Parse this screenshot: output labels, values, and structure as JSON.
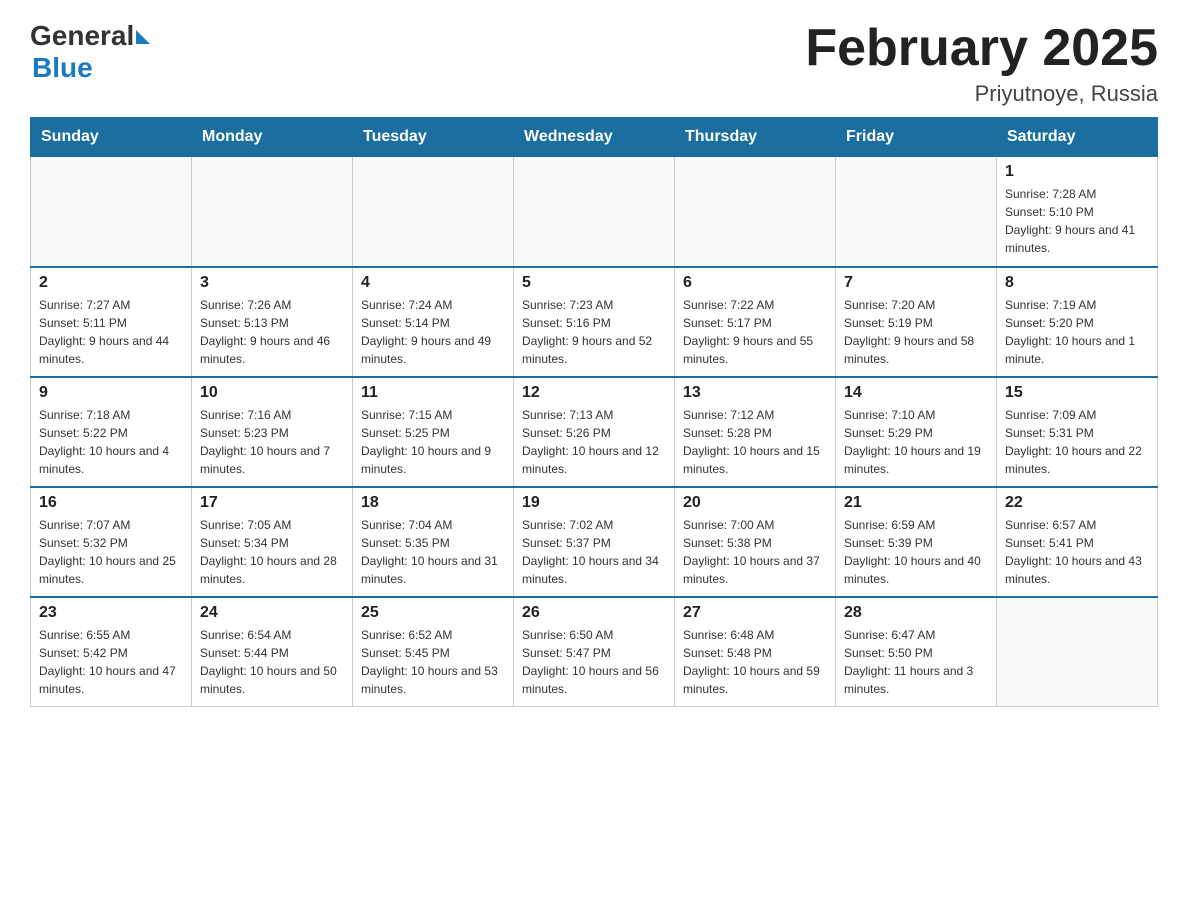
{
  "header": {
    "logo_general": "General",
    "logo_blue": "Blue",
    "month_title": "February 2025",
    "location": "Priyutnoye, Russia"
  },
  "days_of_week": [
    "Sunday",
    "Monday",
    "Tuesday",
    "Wednesday",
    "Thursday",
    "Friday",
    "Saturday"
  ],
  "weeks": [
    {
      "days": [
        {
          "number": "",
          "info": ""
        },
        {
          "number": "",
          "info": ""
        },
        {
          "number": "",
          "info": ""
        },
        {
          "number": "",
          "info": ""
        },
        {
          "number": "",
          "info": ""
        },
        {
          "number": "",
          "info": ""
        },
        {
          "number": "1",
          "info": "Sunrise: 7:28 AM\nSunset: 5:10 PM\nDaylight: 9 hours and 41 minutes."
        }
      ]
    },
    {
      "days": [
        {
          "number": "2",
          "info": "Sunrise: 7:27 AM\nSunset: 5:11 PM\nDaylight: 9 hours and 44 minutes."
        },
        {
          "number": "3",
          "info": "Sunrise: 7:26 AM\nSunset: 5:13 PM\nDaylight: 9 hours and 46 minutes."
        },
        {
          "number": "4",
          "info": "Sunrise: 7:24 AM\nSunset: 5:14 PM\nDaylight: 9 hours and 49 minutes."
        },
        {
          "number": "5",
          "info": "Sunrise: 7:23 AM\nSunset: 5:16 PM\nDaylight: 9 hours and 52 minutes."
        },
        {
          "number": "6",
          "info": "Sunrise: 7:22 AM\nSunset: 5:17 PM\nDaylight: 9 hours and 55 minutes."
        },
        {
          "number": "7",
          "info": "Sunrise: 7:20 AM\nSunset: 5:19 PM\nDaylight: 9 hours and 58 minutes."
        },
        {
          "number": "8",
          "info": "Sunrise: 7:19 AM\nSunset: 5:20 PM\nDaylight: 10 hours and 1 minute."
        }
      ]
    },
    {
      "days": [
        {
          "number": "9",
          "info": "Sunrise: 7:18 AM\nSunset: 5:22 PM\nDaylight: 10 hours and 4 minutes."
        },
        {
          "number": "10",
          "info": "Sunrise: 7:16 AM\nSunset: 5:23 PM\nDaylight: 10 hours and 7 minutes."
        },
        {
          "number": "11",
          "info": "Sunrise: 7:15 AM\nSunset: 5:25 PM\nDaylight: 10 hours and 9 minutes."
        },
        {
          "number": "12",
          "info": "Sunrise: 7:13 AM\nSunset: 5:26 PM\nDaylight: 10 hours and 12 minutes."
        },
        {
          "number": "13",
          "info": "Sunrise: 7:12 AM\nSunset: 5:28 PM\nDaylight: 10 hours and 15 minutes."
        },
        {
          "number": "14",
          "info": "Sunrise: 7:10 AM\nSunset: 5:29 PM\nDaylight: 10 hours and 19 minutes."
        },
        {
          "number": "15",
          "info": "Sunrise: 7:09 AM\nSunset: 5:31 PM\nDaylight: 10 hours and 22 minutes."
        }
      ]
    },
    {
      "days": [
        {
          "number": "16",
          "info": "Sunrise: 7:07 AM\nSunset: 5:32 PM\nDaylight: 10 hours and 25 minutes."
        },
        {
          "number": "17",
          "info": "Sunrise: 7:05 AM\nSunset: 5:34 PM\nDaylight: 10 hours and 28 minutes."
        },
        {
          "number": "18",
          "info": "Sunrise: 7:04 AM\nSunset: 5:35 PM\nDaylight: 10 hours and 31 minutes."
        },
        {
          "number": "19",
          "info": "Sunrise: 7:02 AM\nSunset: 5:37 PM\nDaylight: 10 hours and 34 minutes."
        },
        {
          "number": "20",
          "info": "Sunrise: 7:00 AM\nSunset: 5:38 PM\nDaylight: 10 hours and 37 minutes."
        },
        {
          "number": "21",
          "info": "Sunrise: 6:59 AM\nSunset: 5:39 PM\nDaylight: 10 hours and 40 minutes."
        },
        {
          "number": "22",
          "info": "Sunrise: 6:57 AM\nSunset: 5:41 PM\nDaylight: 10 hours and 43 minutes."
        }
      ]
    },
    {
      "days": [
        {
          "number": "23",
          "info": "Sunrise: 6:55 AM\nSunset: 5:42 PM\nDaylight: 10 hours and 47 minutes."
        },
        {
          "number": "24",
          "info": "Sunrise: 6:54 AM\nSunset: 5:44 PM\nDaylight: 10 hours and 50 minutes."
        },
        {
          "number": "25",
          "info": "Sunrise: 6:52 AM\nSunset: 5:45 PM\nDaylight: 10 hours and 53 minutes."
        },
        {
          "number": "26",
          "info": "Sunrise: 6:50 AM\nSunset: 5:47 PM\nDaylight: 10 hours and 56 minutes."
        },
        {
          "number": "27",
          "info": "Sunrise: 6:48 AM\nSunset: 5:48 PM\nDaylight: 10 hours and 59 minutes."
        },
        {
          "number": "28",
          "info": "Sunrise: 6:47 AM\nSunset: 5:50 PM\nDaylight: 11 hours and 3 minutes."
        },
        {
          "number": "",
          "info": ""
        }
      ]
    }
  ]
}
